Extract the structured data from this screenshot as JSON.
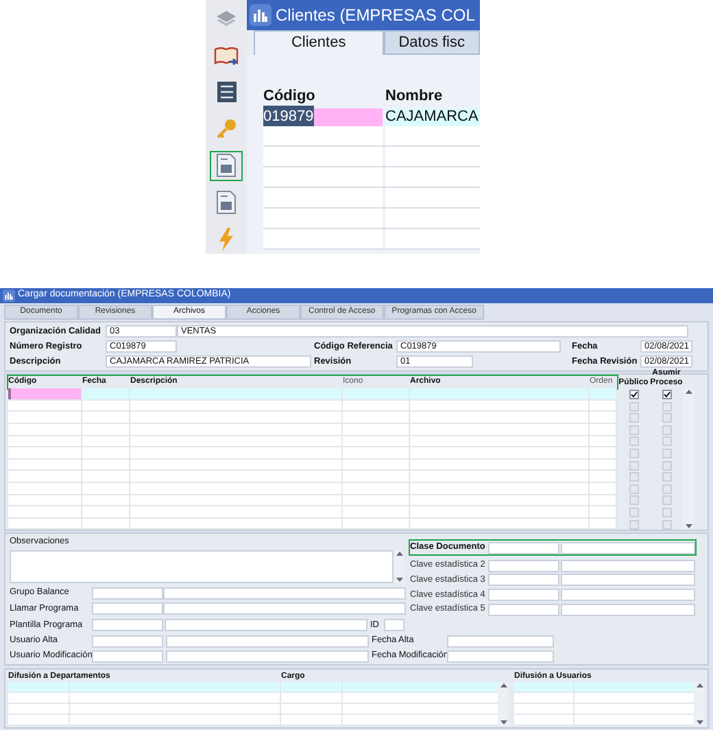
{
  "sidebar": {
    "icons": [
      {
        "kind": "layers",
        "highlighted": false
      },
      {
        "kind": "book",
        "highlighted": false
      },
      {
        "kind": "checklist",
        "highlighted": false
      },
      {
        "kind": "key",
        "highlighted": false
      },
      {
        "kind": "form",
        "highlighted": true
      },
      {
        "kind": "form",
        "highlighted": false
      },
      {
        "kind": "lightning",
        "highlighted": false
      }
    ]
  },
  "clients_window": {
    "title": "Clientes (EMPRESAS COL",
    "tabs": [
      {
        "label": "Clientes",
        "selected": true
      },
      {
        "label": "Datos fisc",
        "selected": false
      }
    ],
    "columns": [
      "Código",
      "Nombre"
    ],
    "rows": [
      {
        "cells": [
          "019879",
          "CAJAMARCA"
        ],
        "selected": true
      }
    ]
  },
  "document_window": {
    "title": "Cargar documentación (EMPRESAS COLOMBIA)",
    "tabs": [
      {
        "label": "Documento",
        "selected": false
      },
      {
        "label": "Revisiones",
        "selected": false
      },
      {
        "label": "Archivos",
        "selected": true
      },
      {
        "label": "Acciones",
        "selected": false
      },
      {
        "label": "Control de Acceso",
        "selected": false
      },
      {
        "label": "Programas con Acceso",
        "selected": false
      }
    ],
    "organizacion_calidad": {
      "label": "Organización Calidad",
      "code": "03",
      "name": "VENTAS"
    },
    "numero_registro": {
      "label": "Número Registro",
      "value": "C019879"
    },
    "codigo_referencia": {
      "label": "Código Referencia",
      "value": "C019879"
    },
    "fecha": {
      "label": "Fecha",
      "value": "02/08/2021"
    },
    "descripcion": {
      "label": "Descripción",
      "value": "CAJAMARCA RAMIREZ PATRICIA"
    },
    "revision": {
      "label": "Revisión",
      "value": "01"
    },
    "fecha_revision": {
      "label": "Fecha Revisión",
      "value": "02/08/2021"
    },
    "files_grid": {
      "highlighted": true,
      "columns": [
        {
          "label": "Código",
          "bold": true
        },
        {
          "label": "Fecha",
          "bold": true
        },
        {
          "label": "Descripción",
          "bold": true
        },
        {
          "label": "Icono",
          "bold": false
        },
        {
          "label": "Archivo",
          "bold": true
        },
        {
          "label": "Orden",
          "bold": false
        }
      ],
      "check_columns": [
        "Público",
        "Asumir Proceso"
      ],
      "rows": [
        {
          "selected": true,
          "publico": true,
          "asumir_proceso": true
        },
        {
          "selected": false,
          "publico": false,
          "asumir_proceso": false
        },
        {
          "selected": false,
          "publico": false,
          "asumir_proceso": false
        },
        {
          "selected": false,
          "publico": false,
          "asumir_proceso": false
        },
        {
          "selected": false,
          "publico": false,
          "asumir_proceso": false
        },
        {
          "selected": false,
          "publico": false,
          "asumir_proceso": false
        },
        {
          "selected": false,
          "publico": false,
          "asumir_proceso": false
        },
        {
          "selected": false,
          "publico": false,
          "asumir_proceso": false
        },
        {
          "selected": false,
          "publico": false,
          "asumir_proceso": false
        },
        {
          "selected": false,
          "publico": false,
          "asumir_proceso": false
        },
        {
          "selected": false,
          "publico": false,
          "asumir_proceso": false
        },
        {
          "selected": false,
          "publico": false,
          "asumir_proceso": false
        }
      ]
    },
    "observaciones": {
      "label": "Observaciones"
    },
    "program_fields": [
      {
        "label": "Grupo Balance"
      },
      {
        "label": "Llamar Programa"
      },
      {
        "label": "Plantilla Programa",
        "id_label": "ID"
      }
    ],
    "claves": [
      {
        "label": "Clase Documento",
        "bold": true,
        "highlighted": true
      },
      {
        "label": "Clave estadística 2",
        "bold": false,
        "highlighted": false
      },
      {
        "label": "Clave estadística 3",
        "bold": false,
        "highlighted": false
      },
      {
        "label": "Clave estadística 4",
        "bold": false,
        "highlighted": false
      },
      {
        "label": "Clave estadística 5",
        "bold": false,
        "highlighted": false
      }
    ],
    "audit": [
      {
        "label": "Usuario Alta",
        "date_label": "Fecha Alta"
      },
      {
        "label": "Usuario Modificación",
        "date_label": "Fecha Modificación"
      }
    ],
    "departments_grid": {
      "columns": [
        "Difusión a Departamentos",
        "Cargo"
      ],
      "rows": [
        {
          "selected": true
        },
        {
          "selected": false
        },
        {
          "selected": false
        },
        {
          "selected": false
        }
      ]
    },
    "users_grid": {
      "columns": [
        "Difusión a Usuarios"
      ],
      "rows": [
        {
          "selected": true
        },
        {
          "selected": false
        },
        {
          "selected": false
        },
        {
          "selected": false
        }
      ]
    }
  }
}
